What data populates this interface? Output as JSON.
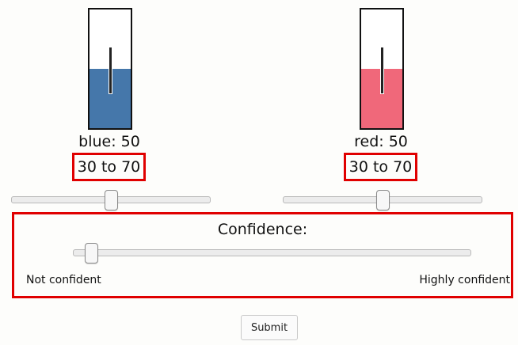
{
  "jars": [
    {
      "name": "blue",
      "value": 50,
      "value_label": "blue: 50",
      "range_label": "30 to 70",
      "fill_color": "#4577aa",
      "fill_fraction": 0.5,
      "needle_fraction": 0.5,
      "slider_fraction": 0.5
    },
    {
      "name": "red",
      "value": 50,
      "value_label": "red: 50",
      "range_label": "30 to 70",
      "fill_color": "#f0687a",
      "fill_fraction": 0.5,
      "needle_fraction": 0.5,
      "slider_fraction": 0.5
    }
  ],
  "confidence": {
    "title": "Confidence:",
    "low_label": "Not confident",
    "high_label": "Highly confident",
    "slider_fraction": 0.03
  },
  "submit_label": "Submit",
  "colors": {
    "highlight_border": "#e00000"
  }
}
